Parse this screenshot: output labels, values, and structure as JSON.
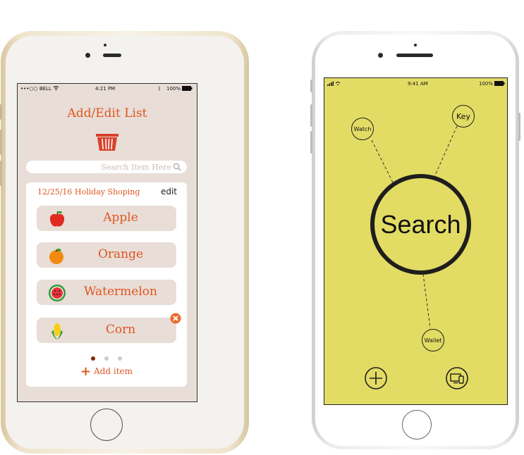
{
  "left_app": {
    "status": {
      "carrier": "•••○○ BELL",
      "time": "4:21 PM",
      "battery": "100%"
    },
    "title": "Add/Edit List",
    "search_placeholder": "Search Item Here",
    "list_title": "12/25/16 Holiday Shoping",
    "edit_label": "edit",
    "items": [
      {
        "label": "Apple",
        "icon": "apple-icon"
      },
      {
        "label": "Orange",
        "icon": "orange-icon"
      },
      {
        "label": "Watermelon",
        "icon": "watermelon-icon"
      },
      {
        "label": "Corn",
        "icon": "corn-icon"
      }
    ],
    "pages": {
      "total": 3,
      "active": 1
    },
    "add_item_label": "Add item",
    "colors": {
      "accent": "#e0551e",
      "background": "#e8ddd7",
      "basket": "#d9402a"
    }
  },
  "right_app": {
    "status": {
      "time": "9:41 AM",
      "battery": "100%"
    },
    "search_label": "Search",
    "nodes": [
      "Watch",
      "Key",
      "Wallet"
    ],
    "toolbar": [
      "add-icon",
      "devices-icon"
    ],
    "colors": {
      "background": "#e3dc64",
      "stroke": "#1e1e1e"
    }
  }
}
